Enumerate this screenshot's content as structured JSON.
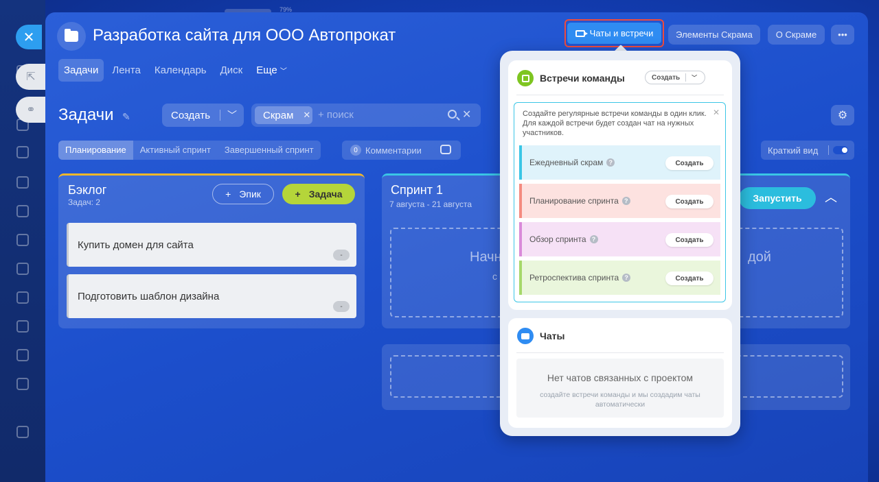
{
  "top_status_percent": "79%",
  "header": {
    "title": "Разработка сайта для ООО Автопрокат",
    "buttons": {
      "chats": "Чаты и встречи",
      "scrum_elements": "Элементы Скрама",
      "about_scrum": "О Скраме",
      "more": "•••"
    }
  },
  "tabs": [
    {
      "label": "Задачи",
      "active": true
    },
    {
      "label": "Лента"
    },
    {
      "label": "Календарь"
    },
    {
      "label": "Диск"
    },
    {
      "label": "Еще"
    }
  ],
  "toolbar": {
    "title": "Задачи",
    "create_label": "Создать",
    "filter_chip": "Скрам",
    "search_placeholder": "+ поиск"
  },
  "views": {
    "planning": "Планирование",
    "active_sprint": "Активный спринт",
    "completed_sprint": "Завершенный спринт",
    "comments_count": "0",
    "comments_label": "Комментарии",
    "compact_label": "Краткий вид"
  },
  "backlog": {
    "title": "Бэклог",
    "count": "Задач: 2",
    "epic_button": "Эпик",
    "task_button": "Задача",
    "tasks": [
      {
        "title": "Купить домен для сайта",
        "badge": "-"
      },
      {
        "title": "Подготовить шаблон дизайна",
        "badge": "-"
      }
    ]
  },
  "sprint": {
    "title": "Спринт 1",
    "dates": "7 августа - 21 августа",
    "start_button": "Запустить",
    "drop_text_left": "Начн",
    "drop_text_right": "дой",
    "drop_text_small": "с"
  },
  "popup": {
    "meetings": {
      "title": "Встречи команды",
      "create_button": "Создать",
      "info": "Создайте регулярные встречи команды в один клик. Для каждой встречи будет создан чат на нужных участников.",
      "items": [
        {
          "label": "Ежедневный скрам",
          "button": "Создать",
          "color": "#dff3fb",
          "border": "#3ac6e6"
        },
        {
          "label": "Планирование спринта",
          "button": "Создать",
          "color": "#fde2e0",
          "border": "#f48b80"
        },
        {
          "label": "Обзор спринта",
          "button": "Создать",
          "color": "#f6e1f6",
          "border": "#d98ad9"
        },
        {
          "label": "Ретроспектива спринта",
          "button": "Создать",
          "color": "#eaf6dc",
          "border": "#a6d86a"
        }
      ]
    },
    "chats": {
      "title": "Чаты",
      "empty_title": "Нет чатов связанных с проектом",
      "empty_sub": "создайте встречи команды и мы создадим чаты автоматически"
    }
  }
}
